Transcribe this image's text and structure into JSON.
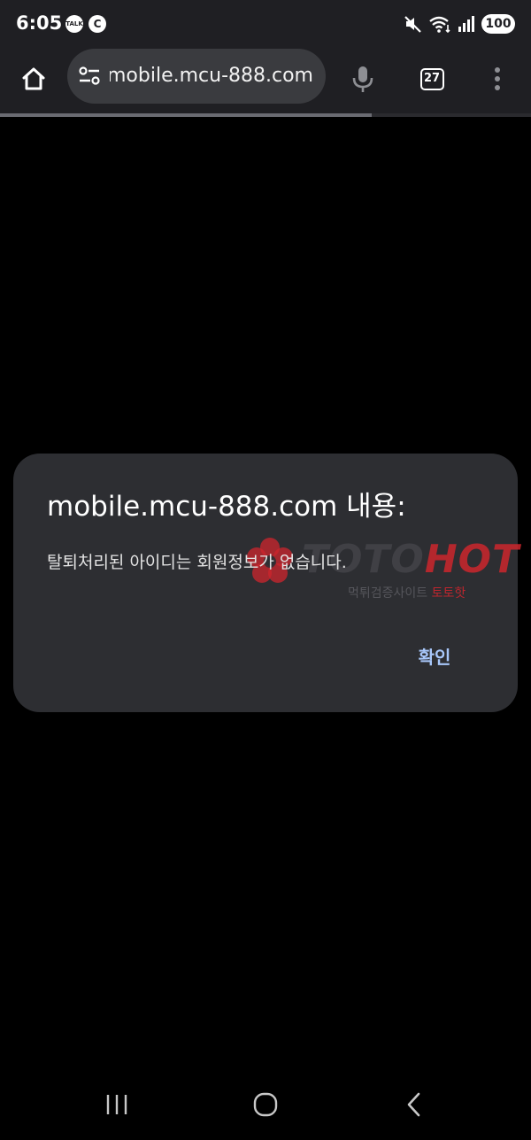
{
  "status_bar": {
    "time": "6:05",
    "notification_talk": "TALK",
    "notification_c": "C",
    "battery": "100"
  },
  "browser": {
    "url": "mobile.mcu-888.com",
    "tab_count": "27",
    "load_progress_percent": 70
  },
  "dialog": {
    "title": "mobile.mcu-888.com 내용:",
    "message": "탈퇴처리된 아이디는 회원정보가 없습니다.",
    "confirm_label": "확인"
  },
  "watermark": {
    "brand_part1": "TOTO",
    "brand_part2": "HOT",
    "subtitle_part1": "먹튀검증사이트 ",
    "subtitle_part2": "토토핫"
  },
  "colors": {
    "background": "#000000",
    "toolbar": "#1f1f23",
    "omnibox": "#3a3b3f",
    "dialog": "#2d2e32",
    "accent": "#a8c7fa",
    "watermark_red": "#cd262d"
  }
}
